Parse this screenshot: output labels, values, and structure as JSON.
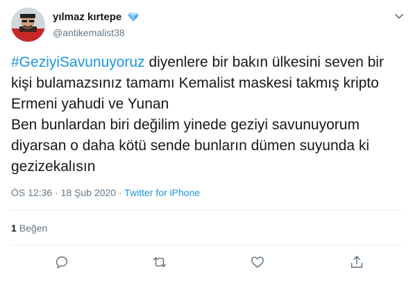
{
  "author": {
    "display_name": "yılmaz kırtepe",
    "handle": "@antikemalist38",
    "badge_icon": "diamond-icon"
  },
  "tweet": {
    "hashtag": "#GeziyiSavunuyoruz",
    "text_after_hashtag": " diyenlere bir bakın ülkesini seven bir kişi bulamazsınız tamamı Kemalist maskesi takmış kripto Ermeni yahudi ve Yunan\nBen bunlardan biri değilim yinede geziyi savunuyorum diyarsan o daha kötü sende bunların dümen suyunda ki gezizekalısın"
  },
  "meta": {
    "time": "ÖS 12:36",
    "separator": "·",
    "date": "18 Şub 2020",
    "source": "Twitter for iPhone"
  },
  "stats": {
    "likes_count": "1",
    "likes_label": "Beğen"
  },
  "actions": [
    "reply-icon",
    "retweet-icon",
    "like-icon",
    "share-icon"
  ],
  "colors": {
    "link": "#1b95e0",
    "secondary": "#657786",
    "primary_text": "#14171a",
    "divider": "#e6ecf0"
  }
}
